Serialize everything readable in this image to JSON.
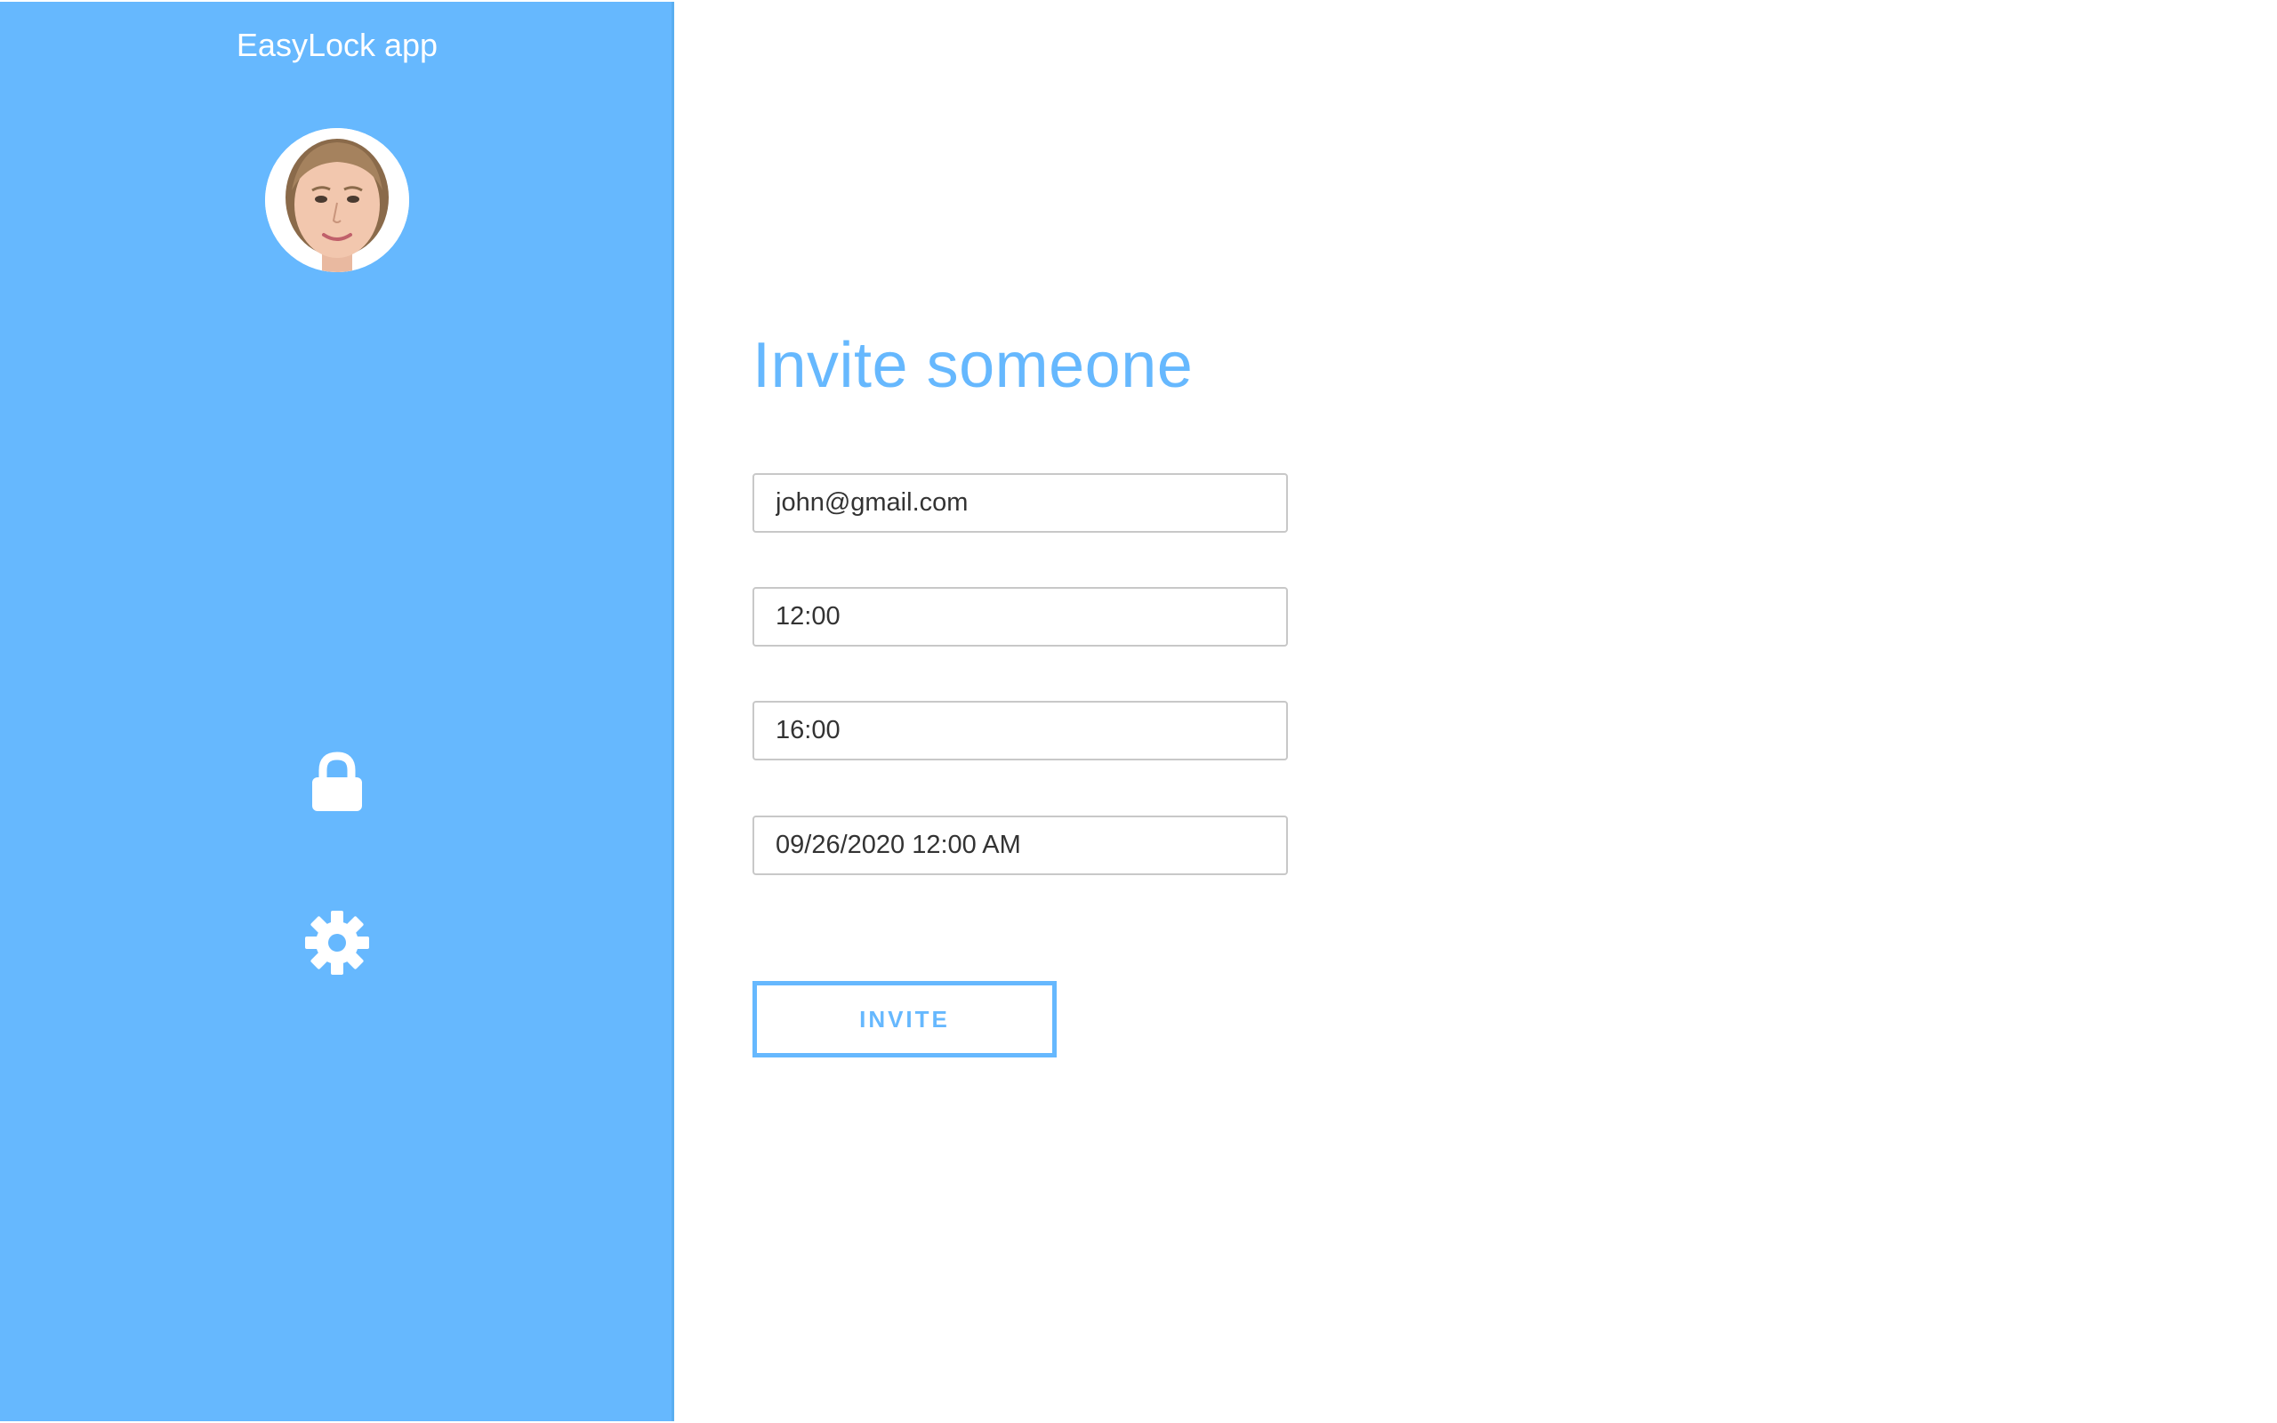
{
  "sidebar": {
    "app_title": "EasyLock app",
    "avatar_alt": "user avatar",
    "nav_items": [
      {
        "name": "lock",
        "icon": "lock-icon"
      },
      {
        "name": "settings",
        "icon": "gear-icon"
      }
    ],
    "background_color": "#66b8fe"
  },
  "main": {
    "title": "Invite someone",
    "fields": {
      "email": "john@gmail.com",
      "start_time": "12:00",
      "end_time": "16:00",
      "date": "09/26/2020 12:00 AM"
    },
    "invite_button": "INVITE",
    "accent_color": "#66b8fe"
  }
}
